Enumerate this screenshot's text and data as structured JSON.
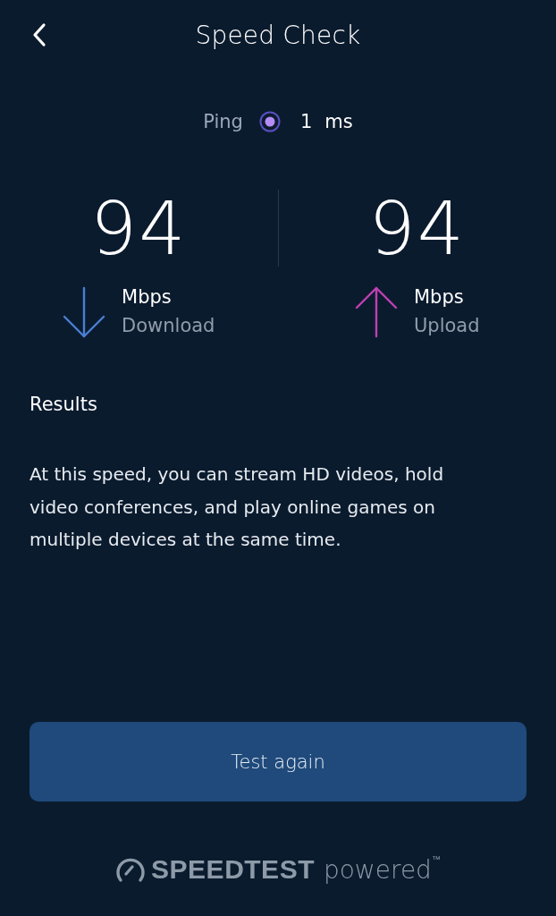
{
  "header": {
    "title": "Speed Check"
  },
  "ping": {
    "label": "Ping",
    "value": "1",
    "unit": "ms"
  },
  "speeds": [
    {
      "kind": "download",
      "value": "94",
      "unit": "Mbps",
      "label": "Download",
      "color": "#4a80d4"
    },
    {
      "kind": "upload",
      "value": "94",
      "unit": "Mbps",
      "label": "Upload",
      "color": "#c23fb4"
    }
  ],
  "results": {
    "heading": "Results",
    "text": "At this speed, you can stream HD videos, hold video conferences, and play online games on multiple devices at the same time."
  },
  "action_button": {
    "label": "Test again"
  },
  "footer": {
    "brand": "SPEEDTEST",
    "tagline": "powered$^{™}$"
  }
}
